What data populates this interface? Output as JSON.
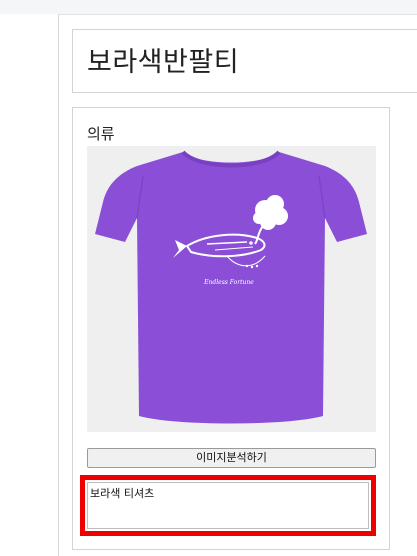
{
  "page": {
    "title": "보라색반팔티"
  },
  "card": {
    "label": "의류",
    "image": {
      "subject": "purple t-shirt with white fish and cloud illustration",
      "shirt_color": "#8a4fd6",
      "background_color": "#efefef",
      "print_text": "Endless Fortune"
    },
    "analyze_button_label": "이미지분석하기",
    "result_text": "보라색 티셔츠",
    "highlight_color": "#ee0000"
  }
}
